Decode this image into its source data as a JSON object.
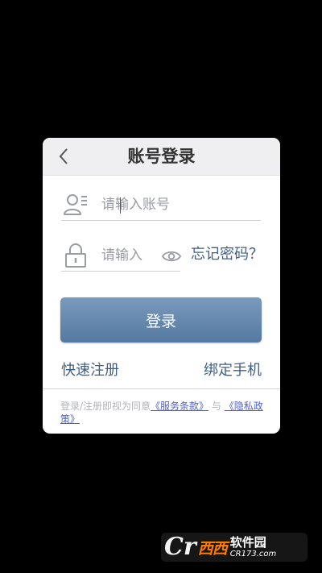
{
  "dialog": {
    "title": "账号登录",
    "back_icon": "chevron-left-icon"
  },
  "account_field": {
    "icon": "user-list-icon",
    "placeholder": "请输入账号"
  },
  "password_field": {
    "icon": "lock-icon",
    "placeholder": "请输入",
    "visibility_icon": "eye-icon"
  },
  "forgot_password": "忘记密码？",
  "login_button": "登录",
  "quick_register": "快速注册",
  "bind_phone": "绑定手机",
  "agreement": {
    "prefix": "登录/注册即视为同意",
    "terms": "《服务条款》",
    "conjunction": "与",
    "privacy": "《隐私政策》"
  },
  "watermark": {
    "mark": "Cr",
    "red": "西西",
    "name": "软件园",
    "url": "CR173.com"
  },
  "colors": {
    "background": "#000000",
    "link": "#3f5f85",
    "button": "#6688ae",
    "policy_link": "#4f61c9"
  }
}
